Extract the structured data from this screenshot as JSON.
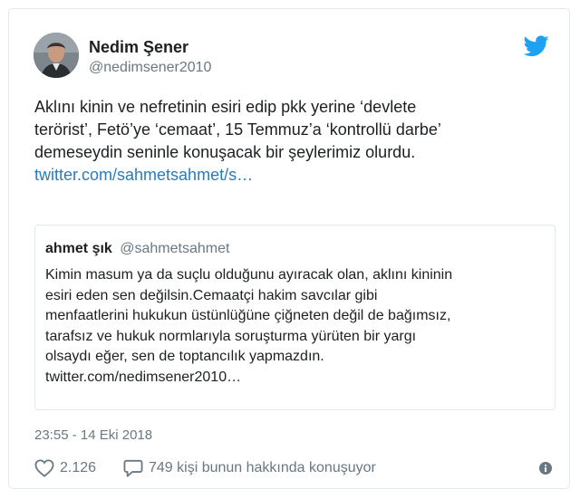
{
  "tweet": {
    "author_name": "Nedim Şener",
    "author_handle": "@nedimsener2010",
    "text_lines": [
      "Aklını kinin ve nefretinin esiri edip pkk yerine ‘devlete",
      "terörist’, Fetö’ye ‘cemaat’, 15 Temmuz’a ‘kontrollü darbe’",
      "demeseydin seninle konuşacak bir şeylerimiz olurdu."
    ],
    "link": "twitter.com/sahmetsahmet/s…",
    "timestamp": "23:55 - 14 Eki 2018",
    "likes": "2.126",
    "conversation": "749 kişi bunun hakkında konuşuyor"
  },
  "quote": {
    "author_name": "ahmet şık",
    "author_handle": "@sahmetsahmet",
    "text_lines": [
      "Kimin masum ya da suçlu olduğunu ayıracak olan, aklını kininin",
      "esiri eden sen değilsin.Cemaatçi hakim savcılar gibi",
      "menfaatlerini hukukun üstünlüğüne çiğneten değil de bağımsız,",
      "tarafsız ve hukuk normlarıyla soruşturma yürüten bir yargı",
      "olsaydı eğer, sen de toptancılık yapmazdın.",
      "twitter.com/nedimsener2010…"
    ]
  },
  "colors": {
    "link": "#2b7bb9",
    "twitter_blue": "#1da1f2",
    "secondary_text": "#697882",
    "border": "#e1e8ed"
  },
  "icons": [
    "twitter-bird-icon",
    "heart-icon",
    "reply-bubble-icon",
    "info-icon"
  ]
}
